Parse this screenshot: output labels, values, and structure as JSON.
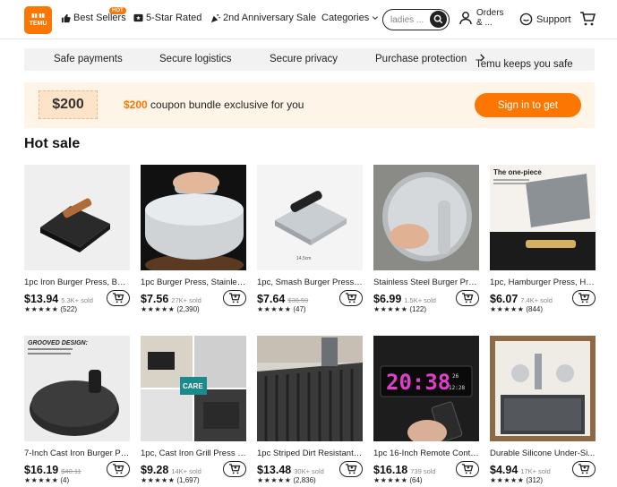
{
  "header": {
    "logo_text": "TEMU",
    "nav": {
      "best_sellers": "Best Sellers",
      "hot_badge": "HOT",
      "five_star": "5-Star Rated",
      "anniversary": "2nd Anniversary Sale",
      "categories": "Categories"
    },
    "search_value": "ladies ...",
    "orders": "Orders & ...",
    "support": "Support"
  },
  "trust_bar": {
    "items": [
      "Safe payments",
      "Secure logistics",
      "Secure privacy",
      "Purchase protection",
      "Temu keeps you safe"
    ]
  },
  "coupon": {
    "tag": "$200",
    "amount": "$200",
    "text": " coupon bundle exclusive for you",
    "button": "Sign in to get"
  },
  "section_title": "Hot sale",
  "products": [
    {
      "name": "1pc Iron Burger Press, Bac...",
      "price": "$13.94",
      "strike": "",
      "sold": "5.3K+ sold",
      "stars": "★★★★★",
      "reviews": "(522)"
    },
    {
      "name": "1pc Burger Press, Stainles...",
      "price": "$7.56",
      "strike": "",
      "sold": "27K+ sold",
      "stars": "★★★★★",
      "reviews": "(2,390)"
    },
    {
      "name": "1pc, Smash Burger Press, ...",
      "price": "$7.64",
      "strike": "$30.59",
      "sold": "",
      "stars": "★★★★★",
      "reviews": "(47)"
    },
    {
      "name": "Stainless Steel Burger Pre...",
      "price": "$6.99",
      "strike": "",
      "sold": "1.5K+ sold",
      "stars": "★★★★★",
      "reviews": "(122)"
    },
    {
      "name": "1pc, Hamburger Press, He...",
      "price": "$6.07",
      "strike": "",
      "sold": "7.4K+ sold",
      "stars": "★★★★★",
      "reviews": "(844)"
    },
    {
      "name": "7-Inch Cast Iron Burger Pr...",
      "price": "$16.19",
      "strike": "$40.11",
      "sold": "",
      "stars": "★★★★★",
      "reviews": "(4)"
    },
    {
      "name": "1pc, Cast Iron Grill Press F...",
      "price": "$9.28",
      "strike": "",
      "sold": "14K+ sold",
      "stars": "★★★★★",
      "reviews": "(1,697)"
    },
    {
      "name": "1pc Striped Dirt Resistant ...",
      "price": "$13.48",
      "strike": "",
      "sold": "30K+ sold",
      "stars": "★★★★★",
      "reviews": "(2,836)"
    },
    {
      "name": "1pc 16-Inch Remote Contr...",
      "price": "$16.18",
      "strike": "",
      "sold": "739 sold",
      "stars": "★★★★★",
      "reviews": "(64)"
    },
    {
      "name": "Durable Silicone Under-Si...",
      "price": "$4.94",
      "strike": "",
      "sold": "17K+ sold",
      "stars": "★★★★★",
      "reviews": "(312)"
    }
  ],
  "image_text": {
    "p5_heading": "The one-piece",
    "p6_heading": "GROOVED DESIGN:",
    "p7_care": "CARE",
    "p9_clock": "20:38",
    "p9_small": "12:28"
  },
  "colors": {
    "brand": "#fb7701",
    "coupon_bg": "#fff4e8"
  }
}
